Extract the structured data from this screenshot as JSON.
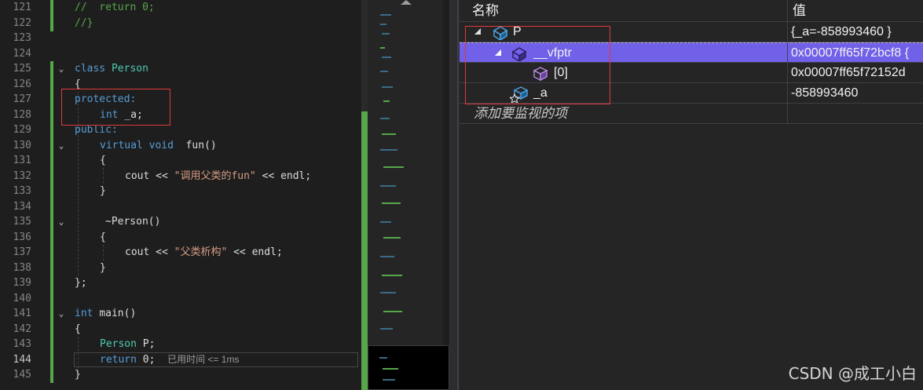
{
  "editor": {
    "current_line": "144",
    "line_numbers": [
      "121",
      "122",
      "123",
      "124",
      "125",
      "126",
      "127",
      "128",
      "129",
      "130",
      "131",
      "132",
      "133",
      "134",
      "135",
      "136",
      "137",
      "138",
      "139",
      "140",
      "141",
      "142",
      "143",
      "144",
      "145"
    ],
    "code": {
      "l121": "//  return 0;",
      "l122": "//}",
      "l125_kw": "class",
      "l125_name": "Person",
      "l126": "{",
      "l127": "protected:",
      "l128_kw": "int",
      "l128_id": "_a;",
      "l129": "public:",
      "l130_kw1": "virtual",
      "l130_kw2": "void",
      "l130_fn": "fun()",
      "l131": "{",
      "l132_a": "cout << ",
      "l132_str": "\"调用父类的fun\"",
      "l132_b": " << endl;",
      "l133": "}",
      "l135_tilde": "~",
      "l135_name": "Person()",
      "l136": "{",
      "l137_a": "cout << ",
      "l137_str": "\"父类析构\"",
      "l137_b": " << endl;",
      "l138": "}",
      "l139": "};",
      "l141_kw": "int",
      "l141_fn": "main()",
      "l142": "{",
      "l143_ty": "Person",
      "l143_id": "P;",
      "l144_kw": "return",
      "l144_num": "0;",
      "l144_perf": "已用时间 <= 1ms",
      "l145": "}"
    }
  },
  "watch": {
    "col_name": "名称",
    "col_value": "值",
    "rows": [
      {
        "name": "P",
        "value": "{_a=-858993460 }"
      },
      {
        "name": "__vfptr",
        "value": "0x00007ff65f72bcf8 {"
      },
      {
        "name": "[0]",
        "value": "0x00007ff65f72152d"
      },
      {
        "name": "_a",
        "value": "-858993460"
      }
    ],
    "add_item": "添加要监视的项"
  },
  "watermark": "CSDN @成工小白",
  "colors": {
    "selected_row": "#7160e8",
    "annotation_box": "#e0393b",
    "keyword": "#569cd6",
    "type": "#4ec9b0",
    "string": "#d69d85",
    "comment": "#57a64a"
  }
}
